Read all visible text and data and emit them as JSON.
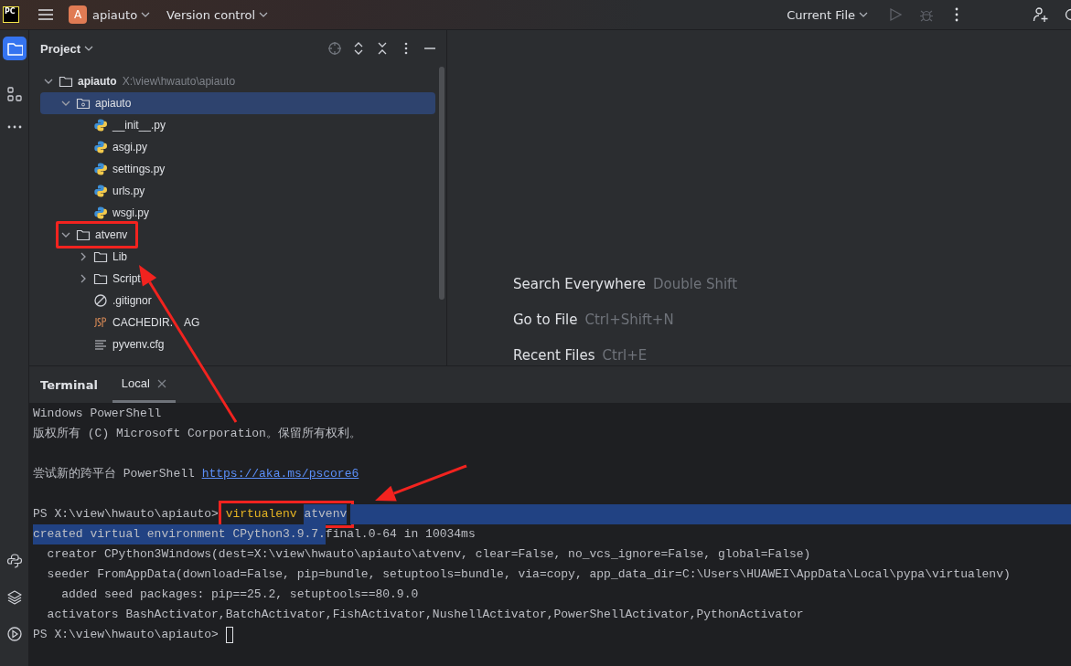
{
  "title_bar": {
    "logo_text": "PC",
    "project_badge": "A",
    "project": "apiauto",
    "vcs": "Version control",
    "run_config": "Current File"
  },
  "tool_strip": {
    "top": [
      {
        "kind": "project",
        "selected": true
      },
      {
        "kind": "structure",
        "selected": false
      },
      {
        "kind": "more",
        "selected": false
      }
    ],
    "bottom": [
      {
        "kind": "python"
      },
      {
        "kind": "layers"
      },
      {
        "kind": "run"
      }
    ]
  },
  "project_panel": {
    "title": "Project",
    "tree": [
      {
        "name": "apiauto",
        "path": "X:\\view\\hwauto\\apiauto",
        "kind": "folder",
        "expanded": true,
        "selected": false,
        "annotated": false,
        "children": [
          {
            "name": "apiauto",
            "kind": "package",
            "expanded": true,
            "selected": true,
            "annotated": false,
            "children": [
              {
                "name": "__init__.py",
                "kind": "python",
                "selected": false,
                "annotated": false
              },
              {
                "name": "asgi.py",
                "kind": "python",
                "selected": false,
                "annotated": false
              },
              {
                "name": "settings.py",
                "kind": "python",
                "selected": false,
                "annotated": false
              },
              {
                "name": "urls.py",
                "kind": "python",
                "selected": false,
                "annotated": false
              },
              {
                "name": "wsgi.py",
                "kind": "python",
                "selected": false,
                "annotated": false
              }
            ]
          },
          {
            "name": "atvenv",
            "kind": "folder",
            "expanded": true,
            "selected": false,
            "annotated": true,
            "children": [
              {
                "name": "Lib",
                "kind": "folder",
                "expanded": false,
                "selected": false,
                "annotated": false
              },
              {
                "name": "Script",
                "kind": "folder",
                "expanded": false,
                "selected": false,
                "annotated": false
              },
              {
                "name": ".gitignor",
                "kind": "ignore",
                "selected": false,
                "annotated": false
              },
              {
                "name": "CACHEDIR.",
                "name_after_arrow": "AG",
                "kind": "jsp",
                "selected": false,
                "annotated": false
              },
              {
                "name": "pyvenv.cfg",
                "kind": "text",
                "selected": false,
                "annotated": false
              }
            ]
          }
        ]
      }
    ]
  },
  "editor_hints": [
    {
      "action": "Search Everywhere",
      "shortcut": "Double Shift"
    },
    {
      "action": "Go to File",
      "shortcut": "Ctrl+Shift+N"
    },
    {
      "action": "Recent Files",
      "shortcut": "Ctrl+E"
    }
  ],
  "terminal": {
    "title": "Terminal",
    "tabs": [
      {
        "label": "Local",
        "selected": true
      }
    ],
    "lines": [
      {
        "segments": [
          {
            "text": "Windows PowerShell",
            "kind": "plain",
            "selected": false,
            "annotated": false
          }
        ]
      },
      {
        "segments": [
          {
            "text": "版权所有 (C) Microsoft Corporation。保留所有权利。",
            "kind": "plain",
            "selected": false,
            "annotated": false
          }
        ]
      },
      {
        "kind": "blank"
      },
      {
        "segments": [
          {
            "text": "尝试新的跨平台 PowerShell ",
            "kind": "plain",
            "selected": false,
            "annotated": false
          },
          {
            "text": "https://aka.ms/pscore6",
            "kind": "link",
            "selected": false,
            "annotated": false
          }
        ]
      },
      {
        "kind": "blank"
      },
      {
        "selected_to_end": true,
        "segments": [
          {
            "text": "PS X:\\view\\hwauto\\apiauto> ",
            "kind": "plain",
            "selected": false,
            "annotated": false
          },
          {
            "text": "virtualenv ",
            "kind": "command",
            "selected": false,
            "annotated": true
          },
          {
            "text": "atvenv",
            "kind": "plain",
            "selected": true,
            "annotated": true
          }
        ]
      },
      {
        "selected_to_end": false,
        "segments": [
          {
            "text": "created virtual environment CPython3.9.7.",
            "kind": "plain",
            "selected": true,
            "annotated": false
          },
          {
            "text": "final.0-64 in 10034ms",
            "kind": "plain",
            "selected": false,
            "annotated": false
          }
        ]
      },
      {
        "segments": [
          {
            "text": "  creator CPython3Windows(dest=X:\\view\\hwauto\\apiauto\\atvenv, clear=False, no_vcs_ignore=False, global=False)",
            "kind": "plain",
            "selected": false,
            "annotated": false
          }
        ]
      },
      {
        "segments": [
          {
            "text": "  seeder FromAppData(download=False, pip=bundle, setuptools=bundle, via=copy, app_data_dir=C:\\Users\\HUAWEI\\AppData\\Local\\pypa\\virtualenv)",
            "kind": "plain",
            "selected": false,
            "annotated": false
          }
        ]
      },
      {
        "segments": [
          {
            "text": "    added seed packages: pip==25.2, setuptools==80.9.0",
            "kind": "plain",
            "selected": false,
            "annotated": false
          }
        ]
      },
      {
        "segments": [
          {
            "text": "  activators BashActivator,BatchActivator,FishActivator,NushellActivator,PowerShellActivator,PythonActivator",
            "kind": "plain",
            "selected": false,
            "annotated": false
          }
        ]
      },
      {
        "segments": [
          {
            "text": "PS X:\\view\\hwauto\\apiauto> ",
            "kind": "plain",
            "selected": false,
            "annotated": false
          },
          {
            "kind": "cursor"
          }
        ]
      }
    ]
  },
  "annotations": [
    {
      "kind": "arrow"
    },
    {
      "kind": "arrow"
    }
  ]
}
